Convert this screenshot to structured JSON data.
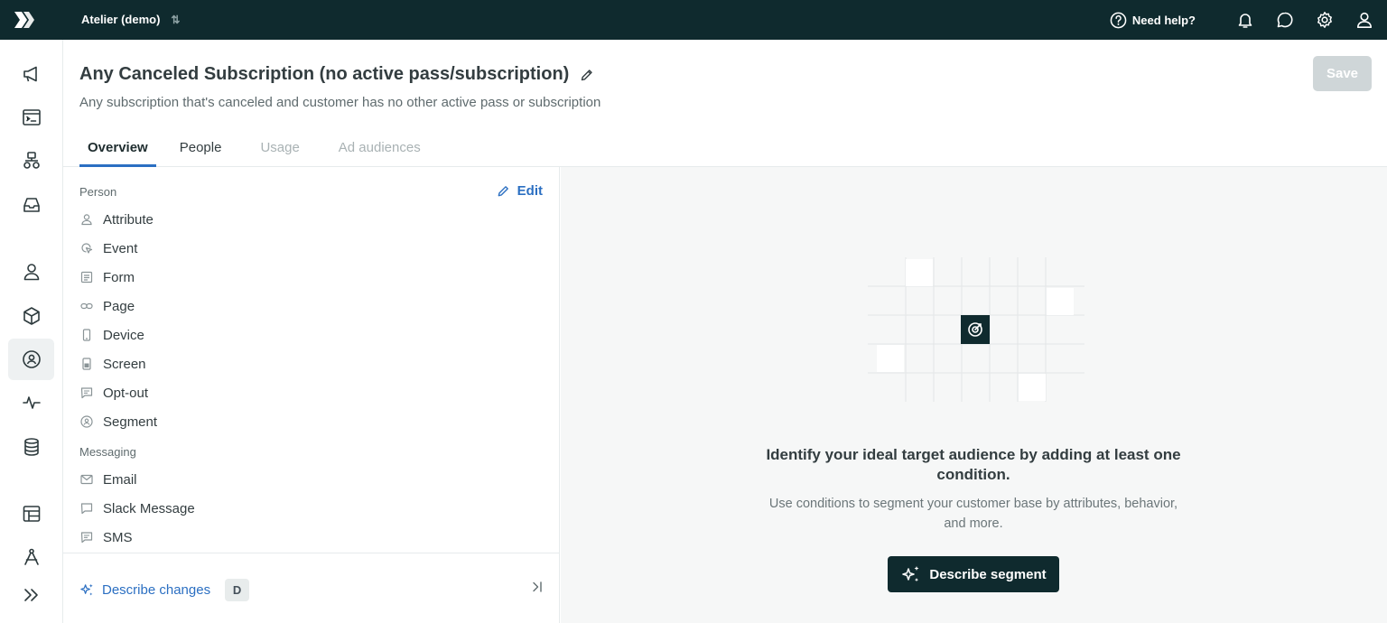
{
  "topbar": {
    "workspace": "Atelier (demo)",
    "help_label": "Need help?"
  },
  "header": {
    "title": "Any Canceled Subscription (no active pass/subscription)",
    "subtitle": "Any subscription that's canceled and customer has no other active pass or subscription",
    "save_label": "Save",
    "tabs": [
      {
        "label": "Overview",
        "state": "active"
      },
      {
        "label": "People",
        "state": "enabled"
      },
      {
        "label": "Usage",
        "state": "disabled"
      },
      {
        "label": "Ad audiences",
        "state": "disabled"
      }
    ]
  },
  "panel": {
    "person_label": "Person",
    "edit_label": "Edit",
    "person_items": [
      {
        "label": "Attribute",
        "icon": "person-icon"
      },
      {
        "label": "Event",
        "icon": "cursor-click-icon"
      },
      {
        "label": "Form",
        "icon": "form-icon"
      },
      {
        "label": "Page",
        "icon": "link-icon"
      },
      {
        "label": "Device",
        "icon": "phone-icon"
      },
      {
        "label": "Screen",
        "icon": "screen-icon"
      },
      {
        "label": "Opt-out",
        "icon": "message-icon"
      },
      {
        "label": "Segment",
        "icon": "segment-icon"
      }
    ],
    "messaging_label": "Messaging",
    "messaging_items": [
      {
        "label": "Email",
        "icon": "envelope-icon"
      },
      {
        "label": "Slack Message",
        "icon": "chat-bubble-icon"
      },
      {
        "label": "SMS",
        "icon": "chat-bubble-icon"
      }
    ],
    "describe_label": "Describe changes",
    "shortcut_key": "D"
  },
  "empty_state": {
    "title": "Identify your ideal target audience by adding at least one condition.",
    "subtitle": "Use conditions to segment your customer base by attributes, behavior, and more.",
    "cta_label": "Describe segment"
  },
  "colors": {
    "topbar": "#0f2a2e",
    "accent": "#2b6fc2",
    "cta": "#0f2a2e",
    "save_disabled": "#cfd6d8"
  }
}
